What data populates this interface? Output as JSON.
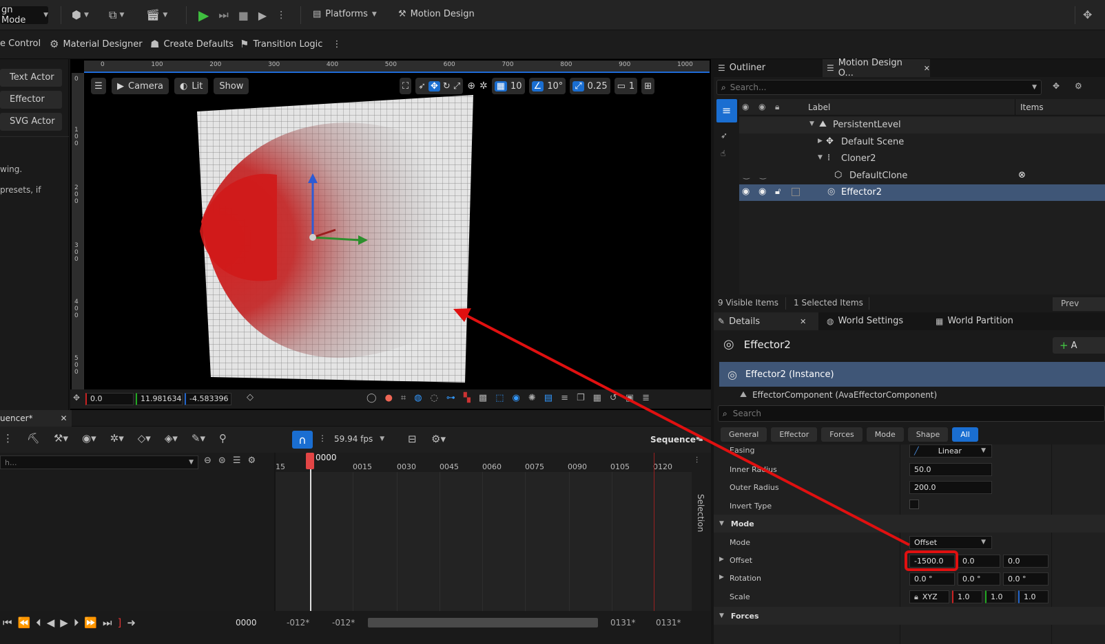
{
  "toolbar": {
    "mode_label": "gn Mode",
    "platforms_label": "Platforms",
    "motion_design_label": "Motion Design"
  },
  "toolbar2": {
    "control_label": "e Control",
    "material_designer_label": "Material Designer",
    "create_defaults_label": "Create Defaults",
    "transition_logic_label": "Transition Logic"
  },
  "left_panel": {
    "actors": [
      "Text Actor",
      "Effector Ac...",
      "SVG Actor"
    ],
    "hint_line1": "wing.",
    "hint_line2": "presets, if"
  },
  "viewport": {
    "ruler_top_ticks": [
      "0",
      "100",
      "200",
      "300",
      "400",
      "500",
      "600",
      "700",
      "800",
      "900",
      "1000"
    ],
    "ruler_left_ticks": [
      "0",
      "1\n0\n0",
      "2\n0\n0",
      "3\n0\n0",
      "4\n0\n0",
      "5\n0\n0"
    ],
    "camera_label": "Camera",
    "lit_label": "Lit",
    "show_label": "Show",
    "grid_snap_value": "10",
    "rotation_snap_value": "10°",
    "scale_snap_value": "0.25",
    "camera_speed_value": "1",
    "coord_x": "0.0",
    "coord_y": "11.981634",
    "coord_z": "-4.583396"
  },
  "sequencer": {
    "tab_label": "uencer*",
    "fps_label": "59.94 fps",
    "sequence_label": "Sequence*",
    "search_placeholder": "h...",
    "current_frame": "0000",
    "playhead_label": "0000",
    "ticks": [
      "15",
      "0015",
      "0030",
      "0045",
      "0060",
      "0075",
      "0090",
      "0105",
      "0120"
    ],
    "selection_label": "Selection",
    "range_start": "-012*",
    "range_start2": "-012*",
    "range_end": "0131*",
    "range_end2": "0131*"
  },
  "outliner": {
    "tab1": "Outliner",
    "tab2": "Motion Design O...",
    "search_placeholder": "Search...",
    "col_label": "Label",
    "col_items": "Items",
    "rows": [
      {
        "label": "PersistentLevel"
      },
      {
        "label": "Default Scene"
      },
      {
        "label": "Cloner2"
      },
      {
        "label": "DefaultClone"
      },
      {
        "label": "Effector2"
      }
    ],
    "visible_items": "9  Visible Items",
    "selected_items": "1  Selected Items",
    "prev_label": "Prev"
  },
  "details": {
    "tab_details": "Details",
    "tab_world_settings": "World Settings",
    "tab_world_partition": "World Partition",
    "actor_name": "Effector2",
    "add_label": "A",
    "instance_label": "Effector2 (Instance)",
    "component_label": "EffectorComponent (AvaEffectorComponent)",
    "search_placeholder": "Search",
    "filters": [
      "General",
      "Effector",
      "Forces",
      "Mode",
      "Shape",
      "All"
    ],
    "easing_label": "Easing",
    "easing_value": "Linear",
    "inner_radius_label": "Inner Radius",
    "inner_radius_value": "50.0",
    "outer_radius_label": "Outer Radius",
    "outer_radius_value": "200.0",
    "invert_type_label": "Invert Type",
    "mode_section": "Mode",
    "mode_label": "Mode",
    "mode_value": "Offset",
    "offset_label": "Offset",
    "offset_x": "-1500.0",
    "offset_y": "0.0",
    "offset_z": "0.0",
    "rotation_label": "Rotation",
    "rotation_x": "0.0 °",
    "rotation_y": "0.0 °",
    "rotation_z": "0.0 °",
    "scale_label": "Scale",
    "scale_lock": "XYZ",
    "scale_x": "1.0",
    "scale_y": "1.0",
    "scale_z": "1.0",
    "forces_section": "Forces"
  },
  "colors": {
    "accent_blue": "#1a6ed1",
    "annotation_red": "#e01010",
    "selection_row": "#3f5677"
  }
}
